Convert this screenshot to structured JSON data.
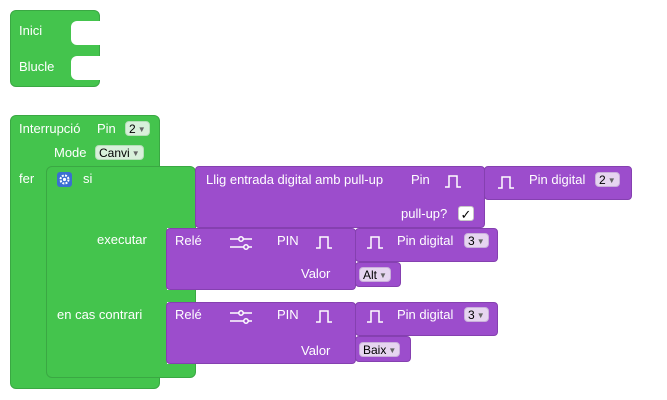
{
  "start_block": {
    "inici": "Inici",
    "bucle": "Blucle"
  },
  "interrupt": {
    "title": "Interrupció",
    "pin_label": "Pin",
    "pin_value": "2",
    "mode_label": "Mode",
    "mode_value": "Canvi",
    "fer_label": "fer"
  },
  "if_block": {
    "si_label": "si",
    "executar_label": "executar",
    "else_label": "en cas contrari"
  },
  "read_block": {
    "label": "Llig entrada digital amb pull-up",
    "pin_label": "Pin",
    "pin_digital_label": "Pin digital",
    "pin_digital_value": "2",
    "pullup_label": "pull-up?",
    "pullup_checked": "✓"
  },
  "relay_1": {
    "label": "Relé",
    "pin_label": "PIN",
    "pin_digital_label": "Pin digital",
    "pin_digital_value": "3",
    "valor_label": "Valor",
    "valor_value": "Alt"
  },
  "relay_2": {
    "label": "Relé",
    "pin_label": "PIN",
    "pin_digital_label": "Pin digital",
    "pin_digital_value": "3",
    "valor_label": "Valor",
    "valor_value": "Baix"
  },
  "colors": {
    "logic_green": "#44c44d",
    "purple": "#9c4dcc",
    "blue_gear": "#3b6fd1"
  },
  "icons": {
    "gear": "gear-icon",
    "pulse": "pulse-icon",
    "relay": "relay-switch-icon"
  }
}
